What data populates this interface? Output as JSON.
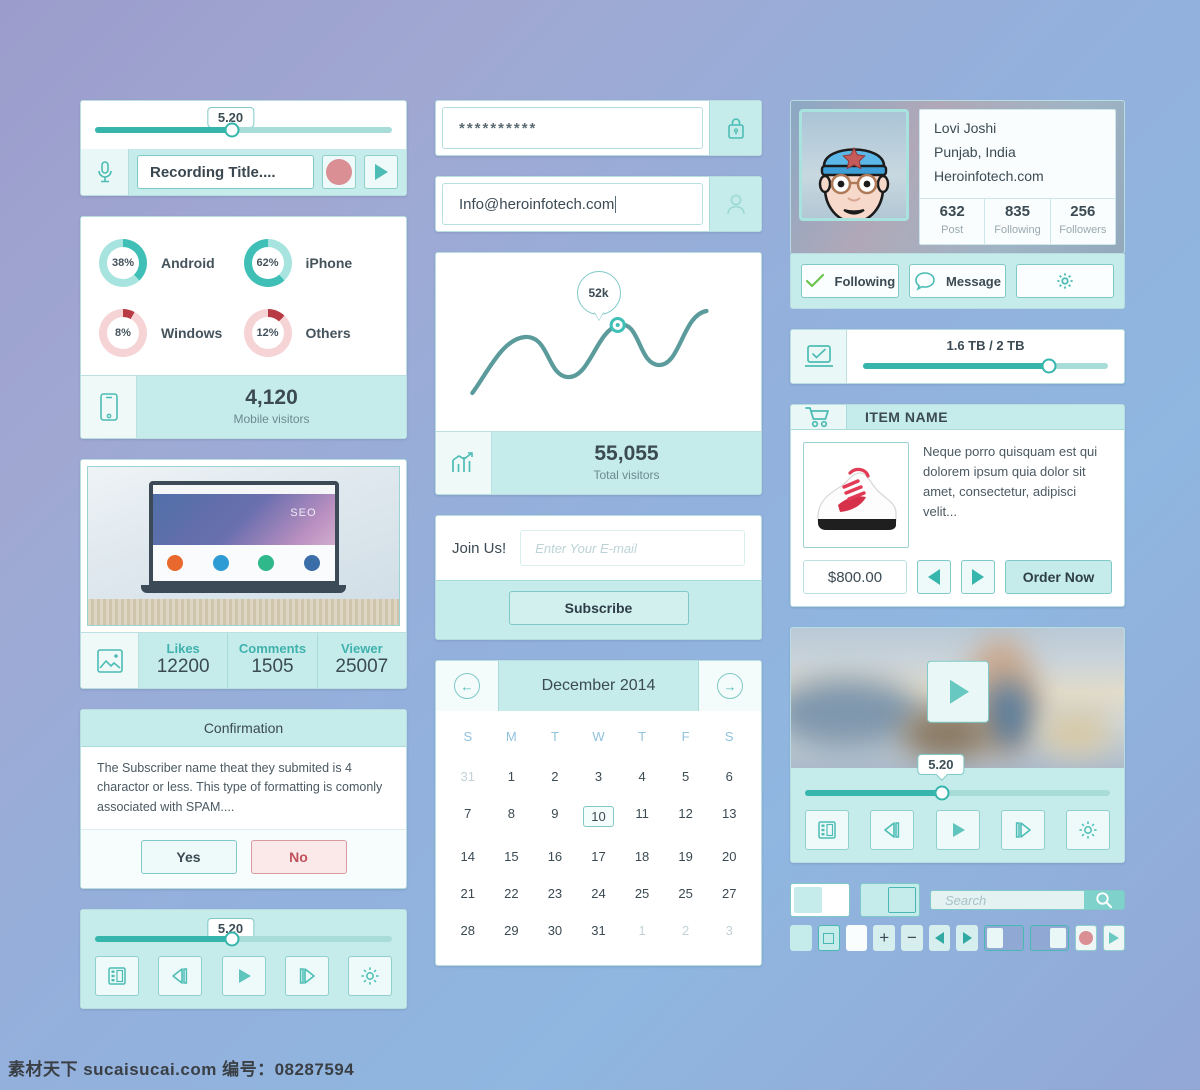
{
  "audio_recorder": {
    "slider_value": "5.20",
    "slider_percent": 46,
    "mic_icon": "microphone-icon",
    "title_value": "Recording Title....",
    "record_icon": "record-dot-icon",
    "play_icon": "play-icon"
  },
  "device_stats": {
    "donuts": [
      {
        "percent": "38%",
        "label": "Android",
        "value": 38,
        "color": "#3fbfb6"
      },
      {
        "percent": "62%",
        "label": "iPhone",
        "value": 62,
        "color": "#3fbfb6"
      },
      {
        "percent": "8%",
        "label": "Windows",
        "value": 8,
        "color": "#b83a45"
      },
      {
        "percent": "12%",
        "label": "Others",
        "value": 12,
        "color": "#b83a45"
      }
    ],
    "total": "4,120",
    "total_caption": "Mobile visitors",
    "icon": "mobile-phone-icon"
  },
  "photo_card": {
    "image_alt": "laptop-showing-seo-website",
    "seo_text": "SEO",
    "gallery_icon": "image-icon",
    "metrics": [
      {
        "label": "Likes",
        "value": "12200"
      },
      {
        "label": "Comments",
        "value": "1505"
      },
      {
        "label": "Viewer",
        "value": "25007"
      }
    ]
  },
  "confirmation": {
    "title": "Confirmation",
    "body": "The Subscriber name theat they submited is 4 charactor or less. This type of formatting is comonly associated with SPAM....",
    "yes_label": "Yes",
    "no_label": "No"
  },
  "video_controls_left": {
    "slider_value": "5.20",
    "slider_percent": 46,
    "buttons": [
      "film-icon",
      "step-backward-icon",
      "play-icon",
      "step-forward-icon",
      "gear-icon"
    ]
  },
  "login_fields": {
    "password_value": "**********",
    "password_icon": "lock-icon",
    "email_value": "Info@heroinfotech.com",
    "email_icon": "user-icon"
  },
  "visitors_chart": {
    "tooltip": "52k",
    "total": "55,055",
    "total_caption": "Total visitors",
    "icon": "bar-chart-growth-icon"
  },
  "subscribe": {
    "label": "Join Us!",
    "placeholder": "Enter Your E-mail",
    "button": "Subscribe"
  },
  "calendar": {
    "title": "December 2014",
    "prev_icon": "arrow-left-circle-icon",
    "next_icon": "arrow-right-circle-icon",
    "weekdays": [
      "S",
      "M",
      "T",
      "W",
      "T",
      "F",
      "S"
    ],
    "selected_day": "10",
    "weeks": [
      [
        {
          "d": "31",
          "m": true
        },
        {
          "d": "1"
        },
        {
          "d": "2"
        },
        {
          "d": "3"
        },
        {
          "d": "4"
        },
        {
          "d": "5"
        },
        {
          "d": "6"
        }
      ],
      [
        {
          "d": "7"
        },
        {
          "d": "8"
        },
        {
          "d": "9"
        },
        {
          "d": "10",
          "s": true
        },
        {
          "d": "11"
        },
        {
          "d": "12"
        },
        {
          "d": "13"
        }
      ],
      [
        {
          "d": "14"
        },
        {
          "d": "15"
        },
        {
          "d": "16"
        },
        {
          "d": "17"
        },
        {
          "d": "18"
        },
        {
          "d": "19"
        },
        {
          "d": "20"
        }
      ],
      [
        {
          "d": "21"
        },
        {
          "d": "22"
        },
        {
          "d": "23"
        },
        {
          "d": "24"
        },
        {
          "d": "25"
        },
        {
          "d": "25"
        },
        {
          "d": "27"
        }
      ],
      [
        {
          "d": "28"
        },
        {
          "d": "29"
        },
        {
          "d": "30"
        },
        {
          "d": "31"
        },
        {
          "d": "1",
          "m": true
        },
        {
          "d": "2",
          "m": true
        },
        {
          "d": "3",
          "m": true
        }
      ]
    ]
  },
  "profile": {
    "avatar_alt": "cartoon-man-with-cap-and-glasses",
    "name": "Lovi Joshi",
    "location": "Punjab, India",
    "website": "Heroinfotech.com",
    "stats": [
      {
        "value": "632",
        "label": "Post"
      },
      {
        "value": "835",
        "label": "Following"
      },
      {
        "value": "256",
        "label": "Followers"
      }
    ],
    "following_label": "Following",
    "following_icon": "check-icon",
    "message_label": "Message",
    "message_icon": "speech-bubble-icon",
    "settings_icon": "gear-icon"
  },
  "storage": {
    "icon": "laptop-check-icon",
    "label": "1.6 TB / 2 TB",
    "percent": 76
  },
  "product": {
    "cart_icon": "shopping-cart-icon",
    "title": "ITEM NAME",
    "image_alt": "white-and-red-sneaker",
    "description": "Neque porro quisquam est qui dolorem ipsum quia dolor sit amet, consectetur, adipisci velit...",
    "price": "$800.00",
    "prev_icon": "triangle-left-icon",
    "next_icon": "triangle-right-icon",
    "order_label": "Order Now"
  },
  "video_player": {
    "thumbnail_alt": "blurred-beach-scene",
    "play_icon": "play-icon",
    "slider_value": "5.20",
    "slider_percent": 45,
    "buttons": [
      "film-icon",
      "step-backward-icon",
      "play-icon",
      "step-forward-icon",
      "gear-icon"
    ]
  },
  "toolbar": {
    "toggle_off": "toggle-switch-off",
    "toggle_on": "toggle-switch-on",
    "search_placeholder": "Search",
    "search_icon": "magnifier-icon",
    "mini_items": [
      "swatch-plain",
      "swatch-nested-square",
      "swatch-white",
      "plus-icon",
      "minus-icon",
      "triangle-left-icon",
      "triangle-right-icon",
      "pill-toggle-left",
      "pill-toggle-right",
      "record-dot-icon",
      "play-icon"
    ],
    "plus_glyph": "+",
    "minus_glyph": "−"
  },
  "watermark": "素材天下 sucaisucai.com 编号：08287594",
  "colors": {
    "accent": "#35b5ab",
    "panel": "#c5ecea",
    "red": "#b83a45"
  }
}
